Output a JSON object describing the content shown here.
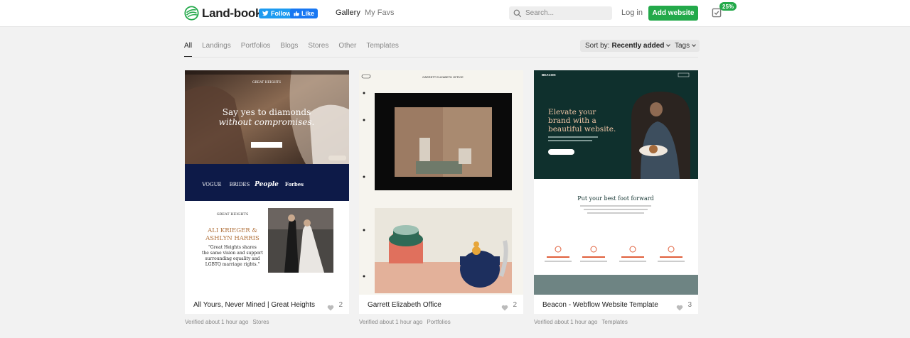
{
  "header": {
    "logo_text": "Land-book",
    "twitter_label": "Follow",
    "facebook_label": "Like",
    "nav": [
      {
        "label": "Gallery"
      },
      {
        "label": "My Favs"
      }
    ],
    "search_placeholder": "Search...",
    "login_label": "Log in",
    "add_website_label": "Add website",
    "progress_badge": "25%"
  },
  "categories": [
    {
      "label": "All",
      "active": true
    },
    {
      "label": "Landings"
    },
    {
      "label": "Portfolios"
    },
    {
      "label": "Blogs"
    },
    {
      "label": "Stores"
    },
    {
      "label": "Other"
    },
    {
      "label": "Templates"
    }
  ],
  "sort": {
    "prefix": "Sort by:",
    "value": "Recently added"
  },
  "tags_label": "Tags",
  "cards": [
    {
      "title": "All Yours, Never Mined | Great Heights",
      "likes": "2",
      "verified": "Verified about 1 hour ago",
      "category": "Stores",
      "preview": {
        "brand": "GREAT HEIGHTS",
        "headline1": "Say yes to diamonds",
        "headline2": "without compromises.",
        "logos": [
          "VOGUE",
          "BRIDES",
          "People",
          "Forbes"
        ],
        "section_brand": "GREAT HEIGHTS",
        "names1": "ALI KRIEGER &",
        "names2": "ASHLYN HARRIS",
        "quote1": "\"Great Heights shares",
        "quote2": "the same vision and support",
        "quote3": "surrounding equality and",
        "quote4": "LGBTQ marriage rights.\""
      }
    },
    {
      "title": "Garrett Elizabeth Office",
      "likes": "2",
      "verified": "Verified about 1 hour ago",
      "category": "Portfolios",
      "preview": {
        "brand": "GARRETT ELIZABETH OFFICE"
      }
    },
    {
      "title": "Beacon - Webflow Website Template",
      "likes": "3",
      "verified": "Verified about 1 hour ago",
      "category": "Templates",
      "preview": {
        "brand": "BEACON",
        "hero1": "Elevate your",
        "hero2": "brand with a",
        "hero3": "beautiful website.",
        "section_title": "Put your best foot forward"
      }
    }
  ],
  "colors": {
    "accent": "#23a94a",
    "twitter": "#1d9bf0",
    "facebook": "#1877f2",
    "beacon_dark": "#0f302d",
    "great_heights_navy": "#0d1a48"
  },
  "icons": [
    "land-book-logo-icon",
    "twitter-bird-icon",
    "facebook-thumb-icon",
    "search-icon",
    "checklist-icon",
    "heart-icon",
    "caret-down-icon"
  ]
}
